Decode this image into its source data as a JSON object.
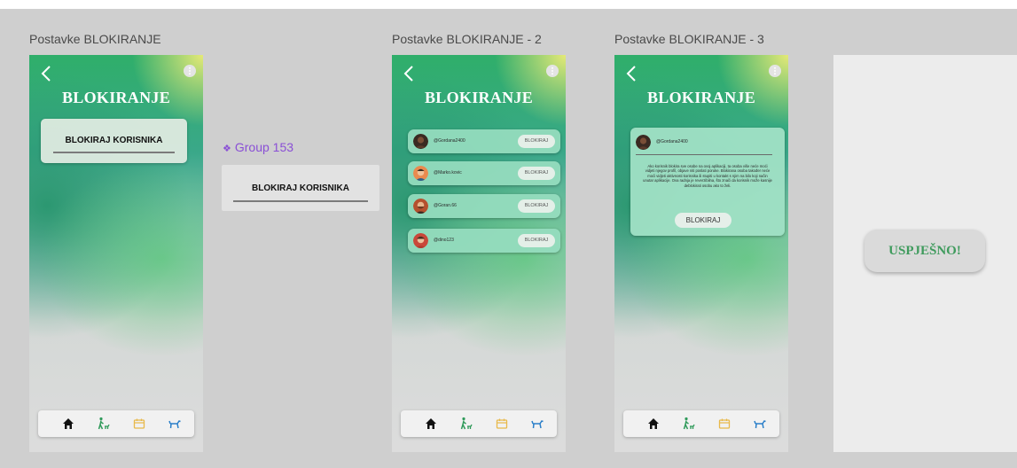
{
  "frames": {
    "f1_label": "Postavke BLOKIRANJE",
    "f2_label": "Postavke BLOKIRANJE - 2",
    "f3_label": "Postavke BLOKIRANJE - 3"
  },
  "phone": {
    "title": "BLOKIRANJE"
  },
  "screen1": {
    "card_label": "BLOKIRAJ KORISNIKA"
  },
  "group": {
    "label": "Group 153",
    "card_label": "BLOKIRAJ KORISNIKA"
  },
  "screen2": {
    "users": [
      {
        "handle": "@Gordana2400",
        "button": "BLOKIRAJ"
      },
      {
        "handle": "@Marko.kovic",
        "button": "BLOKIRAJ"
      },
      {
        "handle": "@Goran.66",
        "button": "BLOKIRAJ"
      },
      {
        "handle": "@dino123",
        "button": "BLOKIRAJ"
      }
    ]
  },
  "screen3": {
    "handle": "@Gordana2400",
    "description": "Ako korisnik blokira sve osobe na ovoj aplikaciji, ta osoba više neće moći vidjeti njegov profil, objave niti poslati poruke. Blokirana osoba također neće moći vidjeti aktivnosti korisnika ili stupiti u kontakt s njim na bilo koji način unutar aplikacije. Ova radnja je reverzibilna, što znači da korisnik može kasnije deblokirati osobu ako to želi.",
    "button": "BLOKIRAJ"
  },
  "success": {
    "label": "USPJEŠNO!"
  },
  "nav_icons": [
    "home-icon",
    "dog-walk-icon",
    "calendar-icon",
    "dog-icon"
  ],
  "colors": {
    "accent_green": "#3f9b5d",
    "group_purple": "#8a4fd6",
    "card_mint": "#96ddbe"
  }
}
